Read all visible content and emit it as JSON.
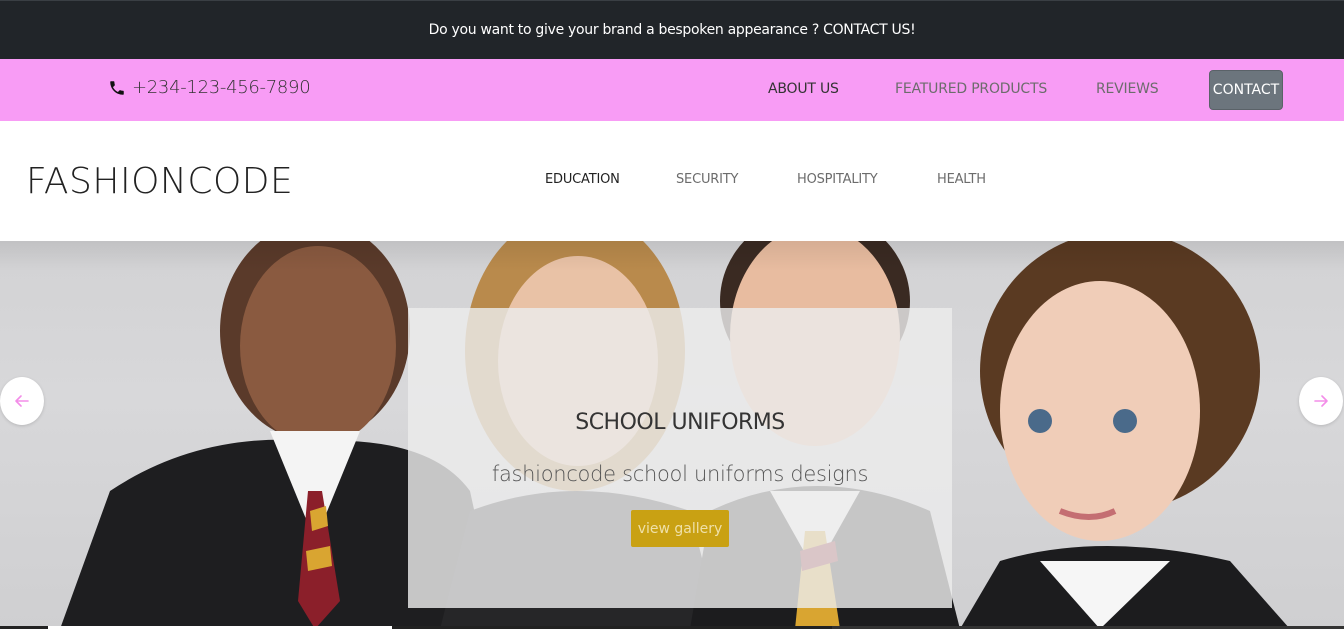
{
  "announcement": {
    "text": "Do you want to give your brand a bespoken appearance ?  CONTACT US!"
  },
  "contact_bar": {
    "phone_icon": "phone-icon",
    "phone": "+234-123-456-7890",
    "links": {
      "about": "ABOUT US",
      "featured": "FEATURED PRODUCTS",
      "reviews": "REVIEWS"
    },
    "contact_button": "CONTACT",
    "background": "#f89cf5"
  },
  "navbar": {
    "brand": "FASHIONCODE",
    "items": {
      "education": "EDUCATION",
      "security": "SECURITY",
      "hospitality": "HOSPITALITY",
      "health": "HEALTH"
    }
  },
  "hero": {
    "title": "SCHOOL UNIFORMS",
    "subtitle": "fashioncode school uniforms designs",
    "button": "view gallery",
    "button_color": "#c9a113",
    "arrow_color": "#f38de8",
    "prev_icon": "arrow-left-icon",
    "next_icon": "arrow-right-icon"
  }
}
